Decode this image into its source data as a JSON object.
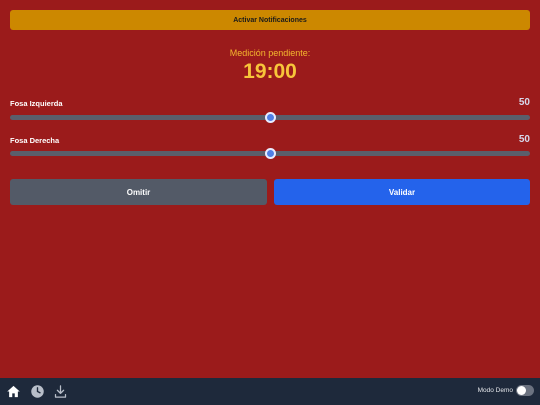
{
  "notifications": {
    "button_label": "Activar Notificaciones"
  },
  "pending": {
    "label": "Medición pendiente:",
    "time": "19:00"
  },
  "sliders": [
    {
      "label": "Fosa Izquierda",
      "value": "50",
      "fraction": 0.5
    },
    {
      "label": "Fosa Derecha",
      "value": "50",
      "fraction": 0.5
    }
  ],
  "actions": {
    "omit_label": "Omitir",
    "validate_label": "Validar"
  },
  "bottom_nav": {
    "icons": [
      "home-icon",
      "clock-icon",
      "download-icon"
    ],
    "demo_label": "Modo Demo",
    "demo_enabled": false
  },
  "colors": {
    "background": "#9b1b1b",
    "accent": "#cc8800",
    "primary": "#2463eb",
    "secondary": "#535a67",
    "time": "#f7c53a"
  }
}
